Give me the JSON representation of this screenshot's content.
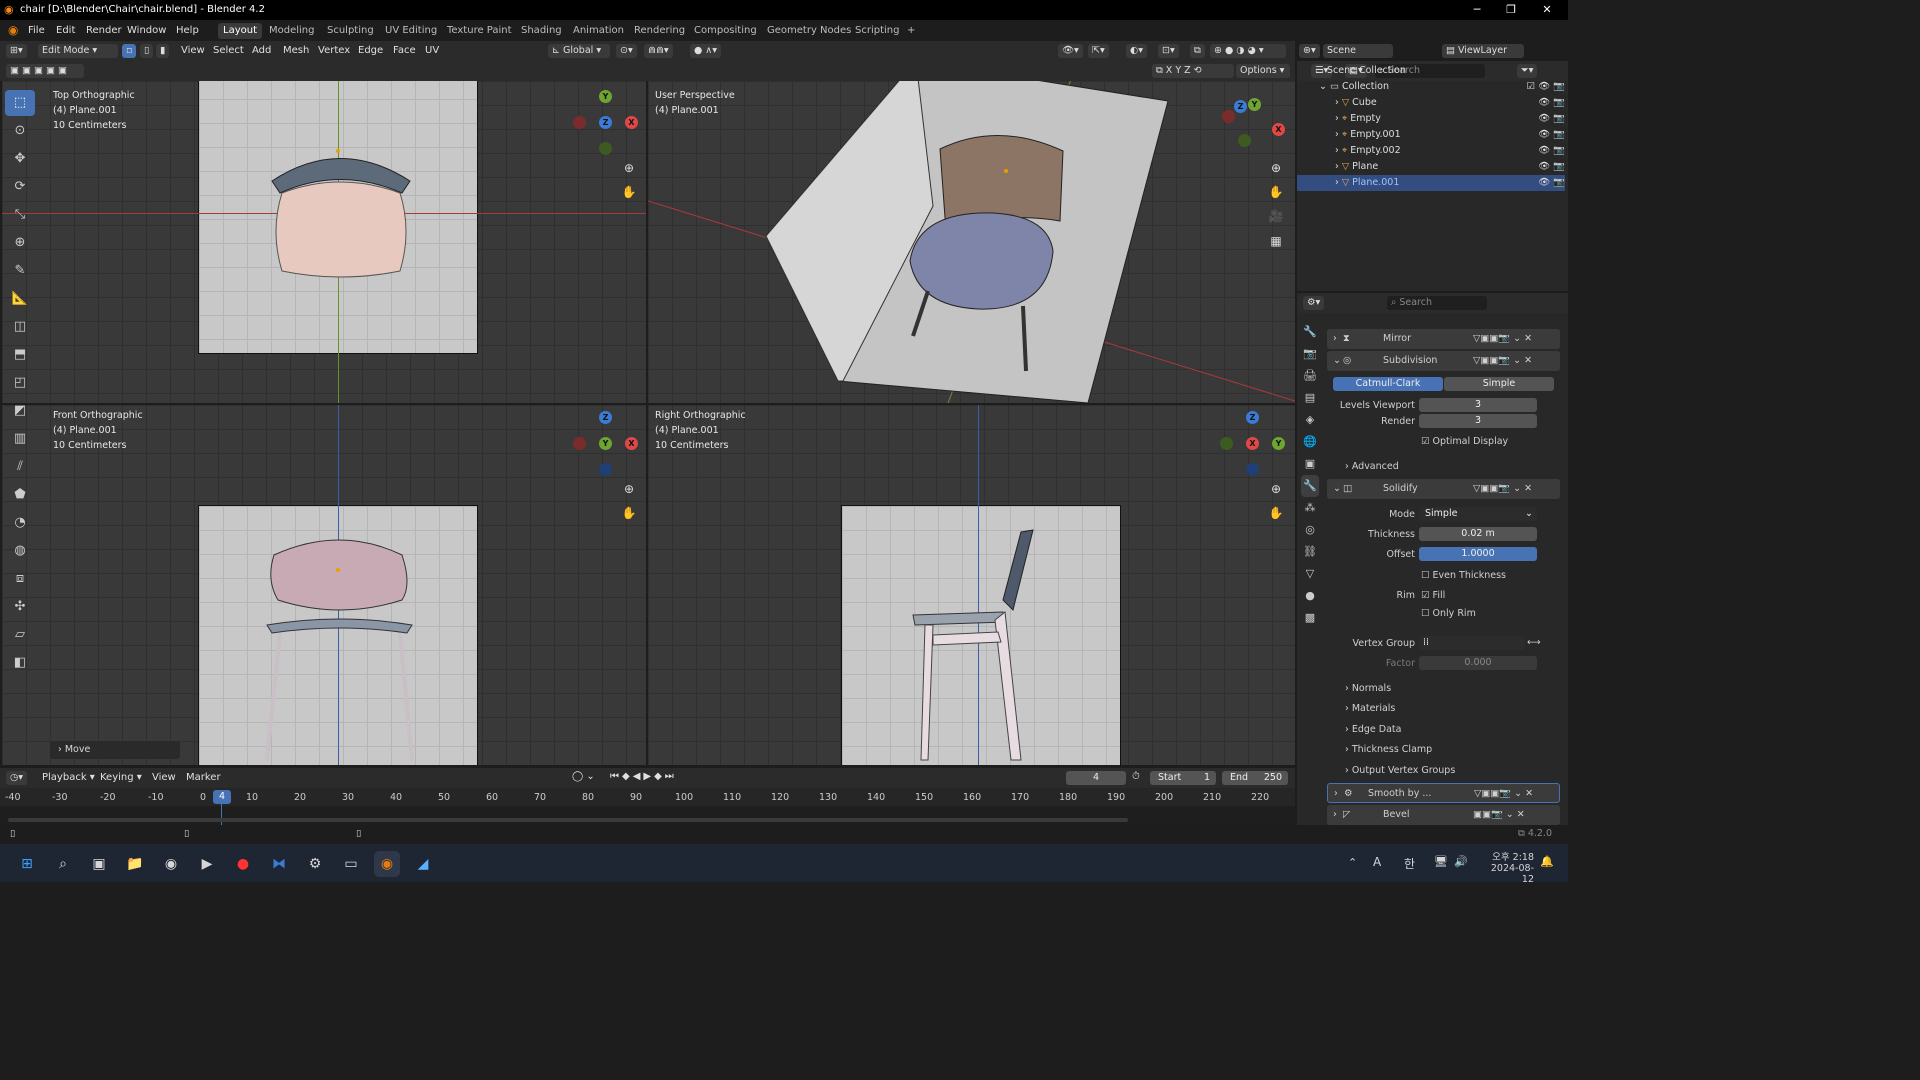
{
  "title": "chair [D:\\Blender\\Chair\\chair.blend] - Blender 4.2",
  "menus": [
    "File",
    "Edit",
    "Render",
    "Window",
    "Help"
  ],
  "workspaces": [
    "Layout",
    "Modeling",
    "Sculpting",
    "UV Editing",
    "Texture Paint",
    "Shading",
    "Animation",
    "Rendering",
    "Compositing",
    "Geometry Nodes",
    "Scripting",
    "+"
  ],
  "header": {
    "mode": "Edit Mode",
    "items": [
      "View",
      "Select",
      "Add",
      "Mesh",
      "Vertex",
      "Edge",
      "Face",
      "UV"
    ],
    "transform": "Global",
    "options": "Options"
  },
  "viewports": [
    {
      "name": "Top Orthographic",
      "obj": "(4) Plane.001",
      "scale": "10 Centimeters"
    },
    {
      "name": "User Perspective",
      "obj": "(4) Plane.001",
      "scale": ""
    },
    {
      "name": "Front Orthographic",
      "obj": "(4) Plane.001",
      "scale": "10 Centimeters"
    },
    {
      "name": "Right Orthographic",
      "obj": "(4) Plane.001",
      "scale": "10 Centimeters"
    }
  ],
  "last_op": "Move",
  "outliner": {
    "scene": "Scene",
    "viewlayer": "ViewLayer",
    "search": "Search",
    "root": "Scene Collection",
    "collection": "Collection",
    "items": [
      "Cube",
      "Empty",
      "Empty.001",
      "Empty.002",
      "Plane",
      "Plane.001"
    ],
    "selected": "Plane.001"
  },
  "properties": {
    "search": "Search",
    "modifiers": [
      "Mirror",
      "Subdivision",
      "Solidify",
      "Smooth by ...",
      "Bevel"
    ],
    "subdivision": {
      "types": [
        "Catmull-Clark",
        "Simple"
      ],
      "levels_label": "Levels Viewport",
      "levels": "3",
      "render_label": "Render",
      "render": "3",
      "optimal": "Optimal Display",
      "advanced": "Advanced"
    },
    "solidify": {
      "mode_label": "Mode",
      "mode": "Simple",
      "thickness_label": "Thickness",
      "thickness": "0.02 m",
      "offset_label": "Offset",
      "offset": "1.0000",
      "even": "Even Thickness",
      "rim_label": "Rim",
      "fill": "Fill",
      "only_rim": "Only Rim",
      "vgroup_label": "Vertex Group",
      "factor_label": "Factor",
      "factor": "0.000"
    },
    "sections": [
      "Normals",
      "Materials",
      "Edge Data",
      "Thickness Clamp",
      "Output Vertex Groups"
    ]
  },
  "timeline": {
    "items": [
      "Playback",
      "Keying",
      "View",
      "Marker"
    ],
    "frame": "4",
    "start_label": "Start",
    "start": "1",
    "end_label": "End",
    "end": "250",
    "ticks": [
      "-40",
      "-30",
      "-20",
      "-10",
      "0",
      "10",
      "20",
      "30",
      "40",
      "50",
      "60",
      "70",
      "80",
      "90",
      "100",
      "110",
      "120",
      "130",
      "140",
      "150",
      "160",
      "170",
      "180",
      "190",
      "200",
      "210",
      "220"
    ]
  },
  "version": "4.2.0",
  "tray": {
    "ime": "A",
    "lang": "한",
    "time": "오후 2:18",
    "date": "2024-08-12"
  }
}
